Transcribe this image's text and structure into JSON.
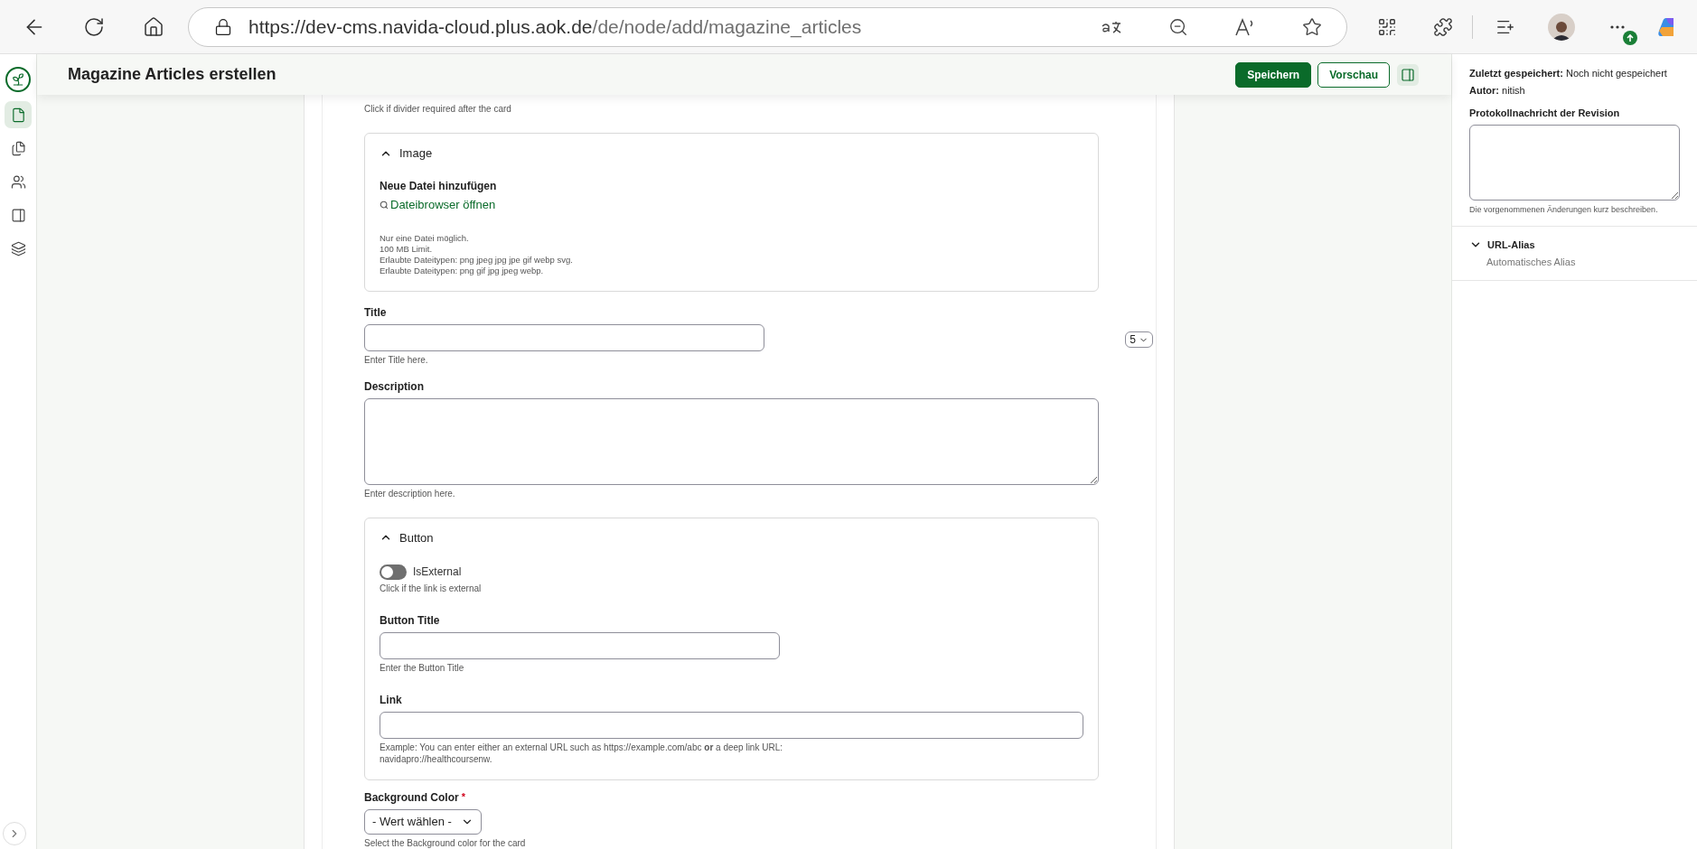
{
  "browser": {
    "url": {
      "host": "https://dev-cms.navida-cloud.plus.aok.de",
      "path": "/de/node/add/magazine_articles"
    }
  },
  "rail": {
    "items": [
      {
        "selected": true
      },
      {
        "selected": false
      },
      {
        "selected": false
      },
      {
        "selected": false
      },
      {
        "selected": false
      }
    ]
  },
  "header": {
    "title": "Magazine Articles erstellen",
    "buttons": [
      {
        "label": "Speichern",
        "kind": "primary"
      },
      {
        "label": "Vorschau",
        "kind": "secondary"
      }
    ]
  },
  "form": {
    "divider_hint": "Click if divider required after the card",
    "image": {
      "legend": "Image",
      "expanded": true,
      "label": "Neue Datei hinzufügen",
      "link": "Dateibrowser öffnen",
      "notes": [
        "Nur eine Datei möglich.",
        "100 MB Limit.",
        "Erlaubte Dateitypen: png jpeg jpg jpe gif webp svg.",
        "Erlaubte Dateitypen: png gif jpg jpeg webp."
      ]
    },
    "title": {
      "label": "Title",
      "hint": "Enter Title here."
    },
    "title_select": {
      "value": "5"
    },
    "description": {
      "label": "Description",
      "hint": "Enter description here."
    },
    "button": {
      "legend": "Button",
      "expanded": true,
      "toggle": {
        "label": "IsExternal",
        "on": false,
        "hint": "Click if the link is external"
      },
      "fields": [
        {
          "label": "Button Title",
          "hint": "Enter the Button Title",
          "wide": false
        },
        {
          "label": "Link",
          "hint": "Example: You can enter either an external URL such as https://example.com/abc **or** a deep link URL: navidapro://healthcoursenw.",
          "wide": true
        }
      ]
    },
    "background": {
      "label": "Background Color",
      "required_mark": "*",
      "value": "- Wert wählen -",
      "hint": "Select the Background color for the card"
    }
  },
  "sidebar": {
    "saved_label": "Zuletzt gespeichert:",
    "saved_value": "Noch nicht gespeichert",
    "author_label": "Autor:",
    "author_value": "nitish",
    "revision": {
      "label": "Protokollnachricht der Revision",
      "hint": "Die vorgenommenen Änderungen kurz beschreiben."
    },
    "url_alias": {
      "label": "URL-Alias",
      "expanded": false,
      "summary": "Automatisches Alias"
    }
  }
}
